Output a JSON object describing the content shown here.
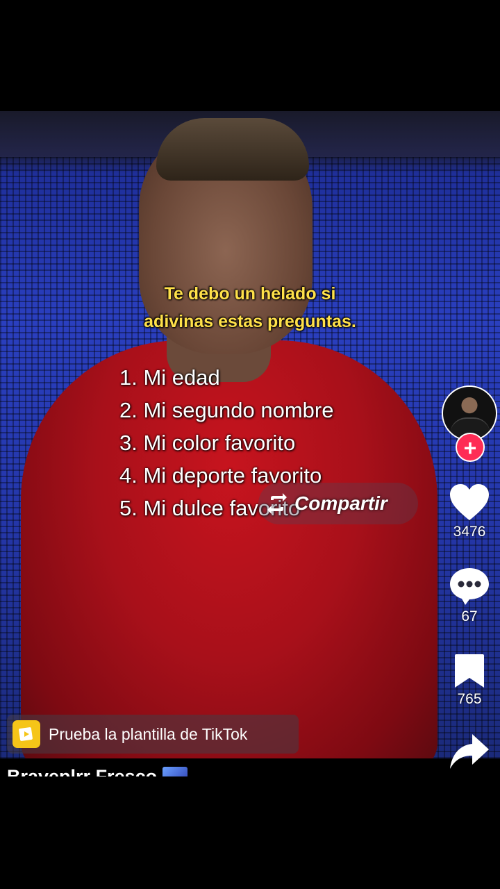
{
  "video": {
    "caption_line_1": "Te debo un helado si",
    "caption_line_2": "adivinas estas preguntas.",
    "list_items": [
      "1. Mi edad",
      "2. Mi segundo nombre",
      "3. Mi color favorito",
      "4. Mi deporte favorito",
      "5. Mi dulce favorito"
    ],
    "share_overlay_label": "Compartir"
  },
  "actions": {
    "follow_symbol": "+",
    "likes": "3476",
    "comments": "67",
    "saves": "765"
  },
  "template_banner": {
    "label": "Prueba la plantilla de TikTok"
  },
  "author": {
    "name": "Braveplrr Fresco"
  },
  "colors": {
    "caption_yellow": "#ffe14a",
    "follow_red": "#fe2c55",
    "template_icon": "#f5c518"
  }
}
